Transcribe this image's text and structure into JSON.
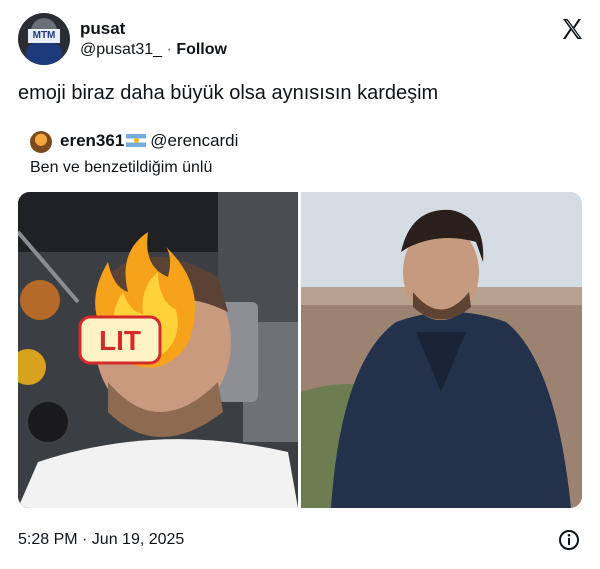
{
  "tweet": {
    "author": {
      "name": "pusat",
      "handle": "@pusat31_",
      "separator": "·",
      "follow_label": "Follow"
    },
    "text": "emoji biraz daha büyük olsa aynısısın kardeşim",
    "timestamp": "5:28 PM · Jun 19, 2025"
  },
  "quoted_tweet": {
    "author": {
      "name": "eren361",
      "handle": "@erencardi",
      "flag": "argentina-flag"
    },
    "text": "Ben ve benzetildiğim ünlü",
    "emoji_sticker_text": "LIT"
  },
  "icons": {
    "brand": "x-logo-icon",
    "info": "info-icon"
  },
  "colors": {
    "text": "#0f1419",
    "secondary": "#536471",
    "background": "#ffffff"
  }
}
